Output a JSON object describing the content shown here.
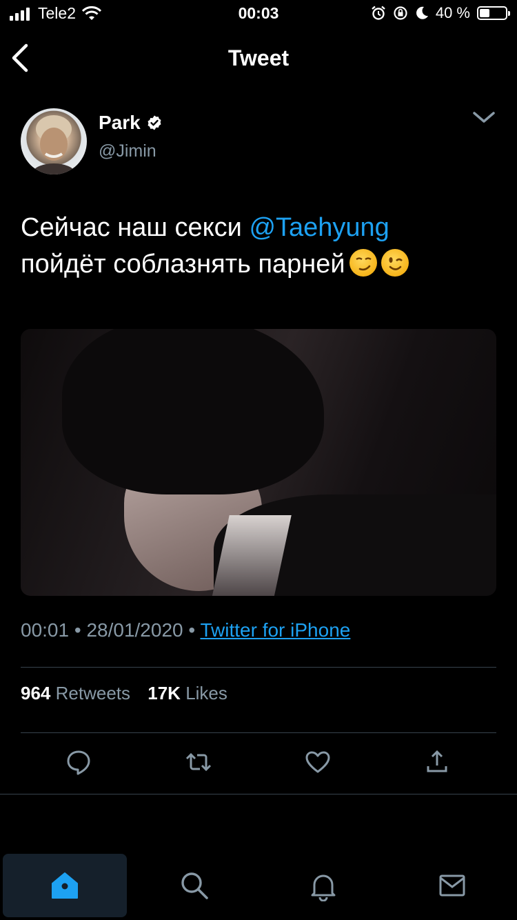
{
  "status_bar": {
    "carrier": "Tele2",
    "time": "00:03",
    "battery": "40 %",
    "battery_level": 0.4
  },
  "nav": {
    "title": "Tweet"
  },
  "tweet": {
    "author_name": "Park",
    "author_handle": "@Jimin",
    "text_part1": "Сейчас наш секси ",
    "mention": "@Taehyung",
    "text_part2": "пойдёт соблазнять парней",
    "emojis": [
      "smirking-face",
      "winking-face"
    ],
    "time": "00:01",
    "date": "28/01/2020",
    "source": "Twitter for iPhone",
    "separator": "•",
    "retweets_count": "964",
    "retweets_label": "Retweets",
    "likes_count": "17K",
    "likes_label": "Likes"
  },
  "tabbar": {
    "items": [
      "home-icon",
      "search-icon",
      "notifications-icon",
      "messages-icon"
    ],
    "active": "home"
  },
  "colors": {
    "accent": "#1da1f2",
    "muted": "#8899a6",
    "divider": "#38444d",
    "background": "#000000"
  }
}
